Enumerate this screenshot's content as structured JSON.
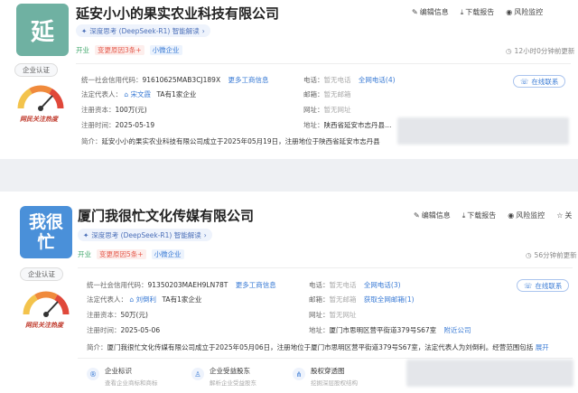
{
  "companies": [
    {
      "logo_text": "延",
      "name": "延安小小的果实农业科技有限公司",
      "actions": [
        "编辑信息",
        "下载报告",
        "风险监控"
      ],
      "ai_label": "深度思考 (DeepSeek-R1) 智能解读",
      "tags": [
        "开业",
        "变更原因3条+",
        "小微企业"
      ],
      "updated": "12小时0分钟前更新",
      "cert_label": "企业认证",
      "gauge_label": "网民关注热度",
      "credit_code_label": "统一社会信用代码：",
      "credit_code": "91610625MAB3CJ189X",
      "credit_code_link": "更多工商信息",
      "legal_rep_label": "法定代表人：",
      "legal_rep": "宋文霞",
      "legal_rep_extra": "TA有1家企业",
      "capital_label": "注册资本：",
      "capital": "100万(元)",
      "reg_date_label": "注册时间：",
      "reg_date": "2025-05-19",
      "phone_label": "电话：",
      "phone": "暂无电话",
      "phone_link": "全网电话(4)",
      "email_label": "邮箱：",
      "email": "暂无邮箱",
      "website_label": "网址：",
      "website": "暂无网址",
      "address_label": "地址：",
      "address": "陕西省延安市志丹县…",
      "online_label": "在线联系",
      "intro_label": "简介：",
      "intro": "延安小小的果实农业科技有限公司成立于2025年05月19日，注册地位于陕西省延安市志丹县"
    },
    {
      "logo_text": "我很忙",
      "name": "厦门我很忙文化传媒有限公司",
      "actions": [
        "编辑信息",
        "下载报告",
        "风险监控",
        "关"
      ],
      "ai_label": "深度思考 (DeepSeek-R1) 智能解读",
      "tags": [
        "开业",
        "变更原因5条+",
        "小微企业"
      ],
      "updated": "56分钟前更新",
      "cert_label": "企业认证",
      "gauge_label": "网民关注热度",
      "credit_code_label": "统一社会信用代码：",
      "credit_code": "91350203MAEH9LN78T",
      "credit_code_link": "更多工商信息",
      "legal_rep_label": "法定代表人：",
      "legal_rep": "刘倒利",
      "legal_rep_extra": "TA有1家企业",
      "capital_label": "注册资本：",
      "capital": "50万(元)",
      "reg_date_label": "注册时间：",
      "reg_date": "2025-05-06",
      "phone_label": "电话：",
      "phone": "暂无电话",
      "phone_link": "全网电话(3)",
      "email_label": "邮箱：",
      "email": "暂无邮箱",
      "email_link": "获取全网邮箱(1)",
      "website_label": "网址：",
      "website": "暂无网址",
      "address_label": "地址：",
      "address": "厦门市思明区营平街道379号S67室",
      "address_link": "附近公司",
      "online_label": "在线联系",
      "intro_label": "简介：",
      "intro": "厦门我很忙文化传媒有限公司成立于2025年05月06日，注册地位于厦门市思明区营平街道379号S67室，法定代表人为刘倒利。经营范围包括",
      "intro_more": "展开",
      "features": [
        {
          "title": "企业标识",
          "sub": "查看企业商标和商标"
        },
        {
          "title": "企业受益股东",
          "sub": "解析企业受益股东"
        },
        {
          "title": "股权穿透图",
          "sub": "挖掘深层股权结构"
        }
      ]
    }
  ]
}
